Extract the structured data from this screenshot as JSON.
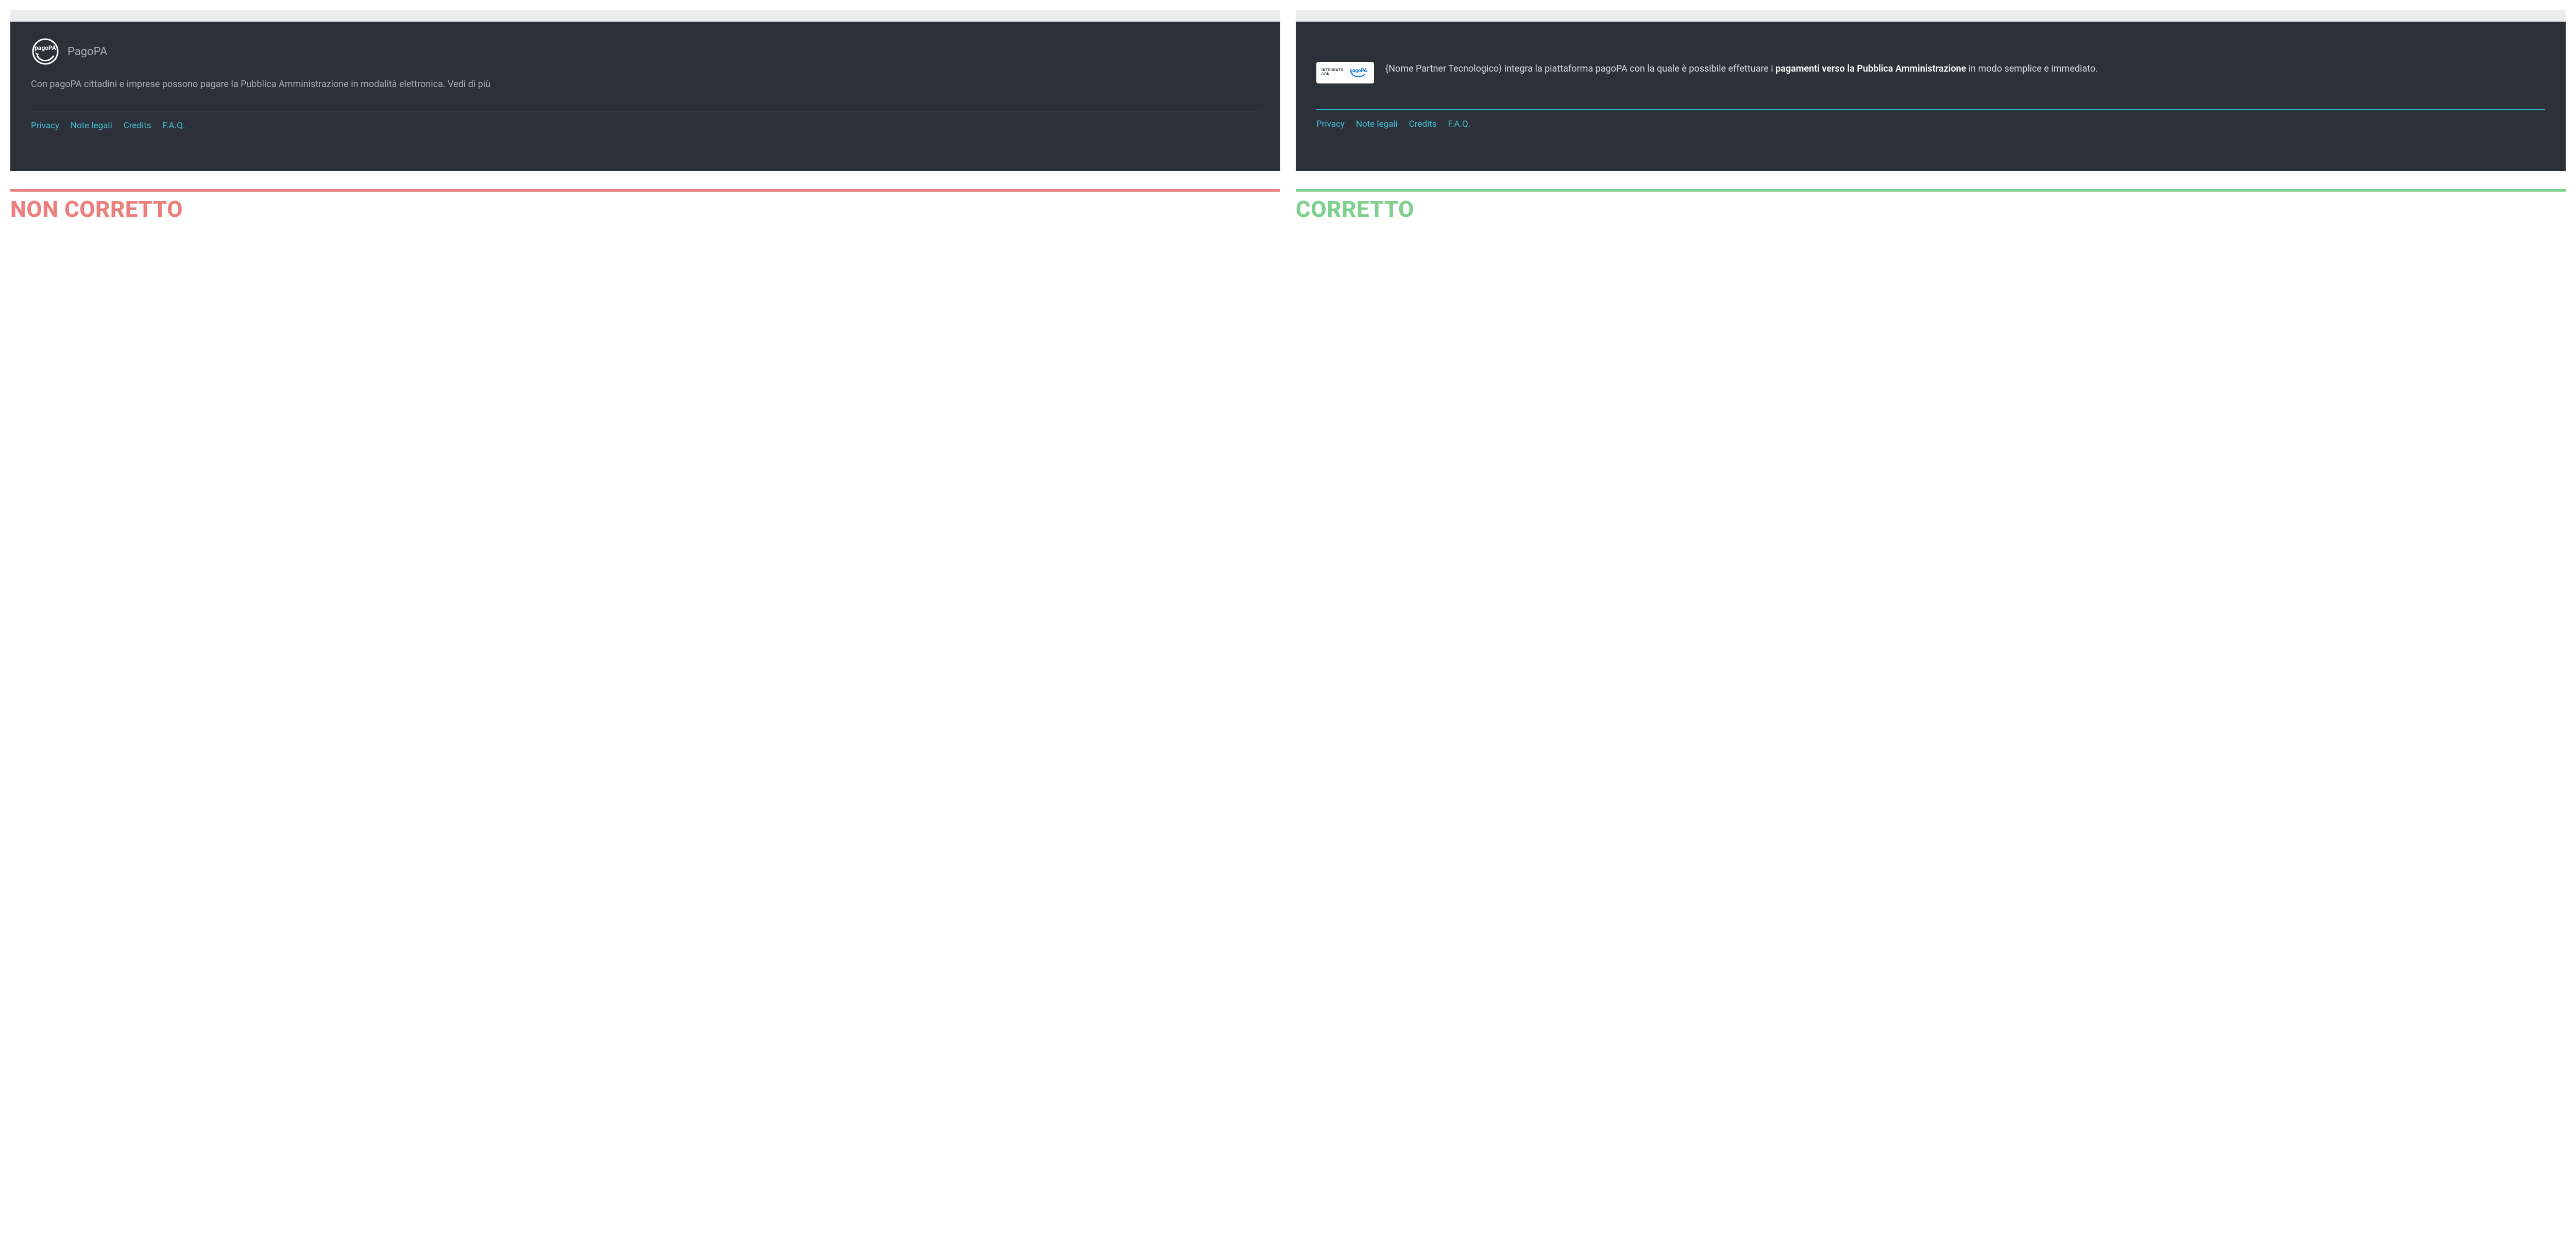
{
  "left": {
    "logo_label": "PagoPA",
    "description": "Con pagoPA cittadini e imprese possono pagare la Pubblica Amministrazione in modalità elettronica. Vedi di più",
    "links": [
      "Privacy",
      "Note legali",
      "Credits",
      "F.A.Q."
    ],
    "verdict": "NON CORRETTO"
  },
  "right": {
    "badge_text_line1": "INTEGRATO",
    "badge_text_line2": "CON",
    "description_prefix": "{Nome Partner Tecnologico} integra la piattaforma pagoPA con la quale è possibile effettuare i ",
    "description_bold": "pagamenti verso la Pubblica Amministrazione",
    "description_suffix": " in modo semplice e immediato.",
    "links": [
      "Privacy",
      "Note legali",
      "Credits",
      "F.A.Q."
    ],
    "verdict": "CORRETTO"
  }
}
